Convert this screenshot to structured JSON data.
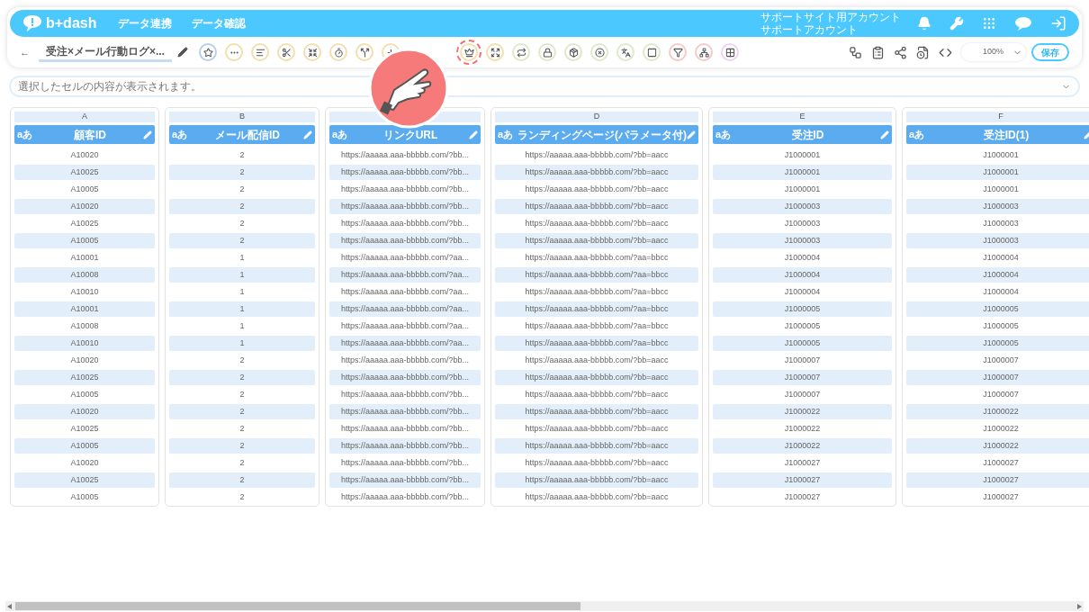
{
  "header": {
    "logo": "b+dash",
    "nav": [
      "データ連携",
      "データ確認"
    ],
    "account": [
      "サポートサイト用アカウント",
      "サポートアカウント"
    ]
  },
  "toolbar": {
    "back": "←",
    "title": "受注×メール行動ログ×...",
    "zoom": "100%",
    "save": "保存",
    "tools": [
      {
        "kind": "star",
        "color": "#b9cfe8",
        "highlighted": false
      },
      {
        "kind": "dots",
        "color": "#f3dfae",
        "highlighted": false
      },
      {
        "kind": "lines",
        "color": "#f3dfae",
        "highlighted": false
      },
      {
        "kind": "scissors",
        "color": "#f3dfae",
        "highlighted": false
      },
      {
        "kind": "merge",
        "color": "#f3dfae",
        "highlighted": false
      },
      {
        "kind": "timer",
        "color": "#f3dfae",
        "highlighted": false
      },
      {
        "kind": "split",
        "color": "#f3dfae",
        "highlighted": false
      },
      {
        "kind": "plus",
        "color": "#f3dfae",
        "highlighted": false
      },
      {
        "kind": "covered"
      },
      {
        "kind": "covered"
      },
      {
        "kind": "crown",
        "color": "#f3dfae",
        "highlighted": true
      },
      {
        "kind": "expand",
        "color": "#f3dfae",
        "highlighted": false
      },
      {
        "kind": "repeat",
        "color": "#dfe8c8",
        "highlighted": false
      },
      {
        "kind": "lock",
        "color": "#dfe8c8",
        "highlighted": false
      },
      {
        "kind": "box",
        "color": "#dfe8c8",
        "highlighted": false
      },
      {
        "kind": "cancel",
        "color": "#dfe8c8",
        "highlighted": false
      },
      {
        "kind": "translate",
        "color": "#dfe8c8",
        "highlighted": false
      },
      {
        "kind": "zero",
        "color": "#dfe8c8",
        "highlighted": false
      },
      {
        "kind": "filter",
        "color": "#f6c9c9",
        "highlighted": false
      },
      {
        "kind": "group",
        "color": "#f6c9c9",
        "highlighted": false
      },
      {
        "kind": "grid",
        "color": "#ecd3f3",
        "highlighted": false
      }
    ]
  },
  "formula_bar": {
    "placeholder": "選択したセルの内容が表示されます。"
  },
  "table": {
    "columns": [
      {
        "letter": "A",
        "type": "aあ",
        "name": "顧客ID"
      },
      {
        "letter": "B",
        "type": "aあ",
        "name": "メール配信ID"
      },
      {
        "type": "aあ",
        "name": "リンクURL"
      },
      {
        "letter": "D",
        "type": "aあ",
        "name": "ランディングページ(パラメータ付)"
      },
      {
        "letter": "E",
        "type": "aあ",
        "name": "受注ID"
      },
      {
        "letter": "F",
        "type": "aあ",
        "name": "受注ID(1)"
      }
    ],
    "rows": [
      [
        "A10020",
        "2",
        "https://aaaaa.aaa-bbbbb.com/?bb...",
        "https://aaaaa.aaa-bbbbb.com/?bb=aacc",
        "J1000001",
        "J1000001"
      ],
      [
        "A10025",
        "2",
        "https://aaaaa.aaa-bbbbb.com/?bb...",
        "https://aaaaa.aaa-bbbbb.com/?bb=aacc",
        "J1000001",
        "J1000001"
      ],
      [
        "A10005",
        "2",
        "https://aaaaa.aaa-bbbbb.com/?bb...",
        "https://aaaaa.aaa-bbbbb.com/?bb=aacc",
        "J1000001",
        "J1000001"
      ],
      [
        "A10020",
        "2",
        "https://aaaaa.aaa-bbbbb.com/?bb...",
        "https://aaaaa.aaa-bbbbb.com/?bb=aacc",
        "J1000003",
        "J1000003"
      ],
      [
        "A10025",
        "2",
        "https://aaaaa.aaa-bbbbb.com/?bb...",
        "https://aaaaa.aaa-bbbbb.com/?bb=aacc",
        "J1000003",
        "J1000003"
      ],
      [
        "A10005",
        "2",
        "https://aaaaa.aaa-bbbbb.com/?bb...",
        "https://aaaaa.aaa-bbbbb.com/?bb=aacc",
        "J1000003",
        "J1000003"
      ],
      [
        "A10001",
        "1",
        "https://aaaaa.aaa-bbbbb.com/?aa...",
        "https://aaaaa.aaa-bbbbb.com/?aa=bbcc",
        "J1000004",
        "J1000004"
      ],
      [
        "A10008",
        "1",
        "https://aaaaa.aaa-bbbbb.com/?aa...",
        "https://aaaaa.aaa-bbbbb.com/?aa=bbcc",
        "J1000004",
        "J1000004"
      ],
      [
        "A10010",
        "1",
        "https://aaaaa.aaa-bbbbb.com/?aa...",
        "https://aaaaa.aaa-bbbbb.com/?aa=bbcc",
        "J1000004",
        "J1000004"
      ],
      [
        "A10001",
        "1",
        "https://aaaaa.aaa-bbbbb.com/?aa...",
        "https://aaaaa.aaa-bbbbb.com/?aa=bbcc",
        "J1000005",
        "J1000005"
      ],
      [
        "A10008",
        "1",
        "https://aaaaa.aaa-bbbbb.com/?aa...",
        "https://aaaaa.aaa-bbbbb.com/?aa=bbcc",
        "J1000005",
        "J1000005"
      ],
      [
        "A10010",
        "1",
        "https://aaaaa.aaa-bbbbb.com/?aa...",
        "https://aaaaa.aaa-bbbbb.com/?aa=bbcc",
        "J1000005",
        "J1000005"
      ],
      [
        "A10020",
        "2",
        "https://aaaaa.aaa-bbbbb.com/?bb...",
        "https://aaaaa.aaa-bbbbb.com/?bb=aacc",
        "J1000007",
        "J1000007"
      ],
      [
        "A10025",
        "2",
        "https://aaaaa.aaa-bbbbb.com/?bb...",
        "https://aaaaa.aaa-bbbbb.com/?bb=aacc",
        "J1000007",
        "J1000007"
      ],
      [
        "A10005",
        "2",
        "https://aaaaa.aaa-bbbbb.com/?bb...",
        "https://aaaaa.aaa-bbbbb.com/?bb=aacc",
        "J1000007",
        "J1000007"
      ],
      [
        "A10020",
        "2",
        "https://aaaaa.aaa-bbbbb.com/?bb...",
        "https://aaaaa.aaa-bbbbb.com/?bb=aacc",
        "J1000022",
        "J1000022"
      ],
      [
        "A10025",
        "2",
        "https://aaaaa.aaa-bbbbb.com/?bb...",
        "https://aaaaa.aaa-bbbbb.com/?bb=aacc",
        "J1000022",
        "J1000022"
      ],
      [
        "A10005",
        "2",
        "https://aaaaa.aaa-bbbbb.com/?bb...",
        "https://aaaaa.aaa-bbbbb.com/?bb=aacc",
        "J1000022",
        "J1000022"
      ],
      [
        "A10020",
        "2",
        "https://aaaaa.aaa-bbbbb.com/?bb...",
        "https://aaaaa.aaa-bbbbb.com/?bb=aacc",
        "J1000027",
        "J1000027"
      ],
      [
        "A10025",
        "2",
        "https://aaaaa.aaa-bbbbb.com/?bb...",
        "https://aaaaa.aaa-bbbbb.com/?bb=aacc",
        "J1000027",
        "J1000027"
      ],
      [
        "A10005",
        "2",
        "https://aaaaa.aaa-bbbbb.com/?bb...",
        "https://aaaaa.aaa-bbbbb.com/?bb=aacc",
        "J1000027",
        "J1000027"
      ]
    ]
  }
}
